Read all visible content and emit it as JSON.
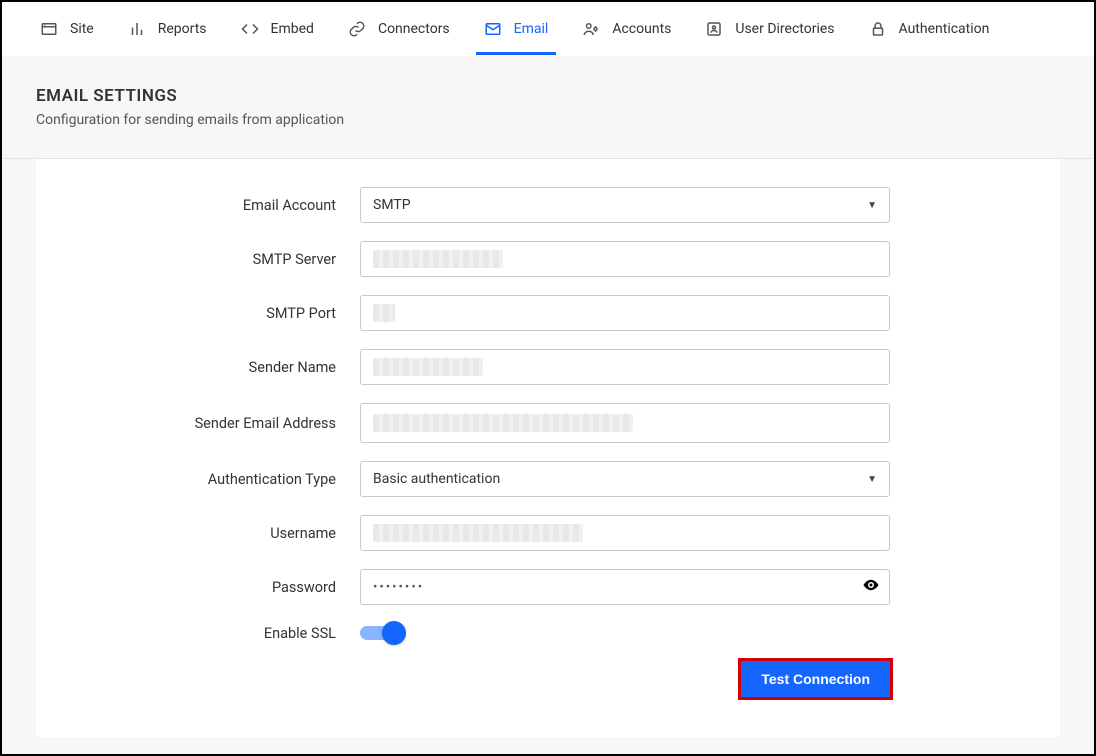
{
  "tabs": [
    {
      "label": "Site",
      "icon": "site"
    },
    {
      "label": "Reports",
      "icon": "reports"
    },
    {
      "label": "Embed",
      "icon": "embed"
    },
    {
      "label": "Connectors",
      "icon": "connectors"
    },
    {
      "label": "Email",
      "icon": "email",
      "active": true
    },
    {
      "label": "Accounts",
      "icon": "accounts"
    },
    {
      "label": "User Directories",
      "icon": "user-directories"
    },
    {
      "label": "Authentication",
      "icon": "authentication"
    }
  ],
  "header": {
    "title": "EMAIL SETTINGS",
    "subtitle": "Configuration for sending emails from application"
  },
  "form": {
    "email_account": {
      "label": "Email Account",
      "value": "SMTP"
    },
    "smtp_server": {
      "label": "SMTP Server",
      "value": ""
    },
    "smtp_port": {
      "label": "SMTP Port",
      "value": ""
    },
    "sender_name": {
      "label": "Sender Name",
      "value": ""
    },
    "sender_email": {
      "label": "Sender Email Address",
      "value": ""
    },
    "auth_type": {
      "label": "Authentication Type",
      "value": "Basic authentication"
    },
    "username": {
      "label": "Username",
      "value": ""
    },
    "password": {
      "label": "Password",
      "value": "••••••••"
    },
    "enable_ssl": {
      "label": "Enable SSL",
      "value": true
    }
  },
  "actions": {
    "test_connection": "Test Connection"
  }
}
